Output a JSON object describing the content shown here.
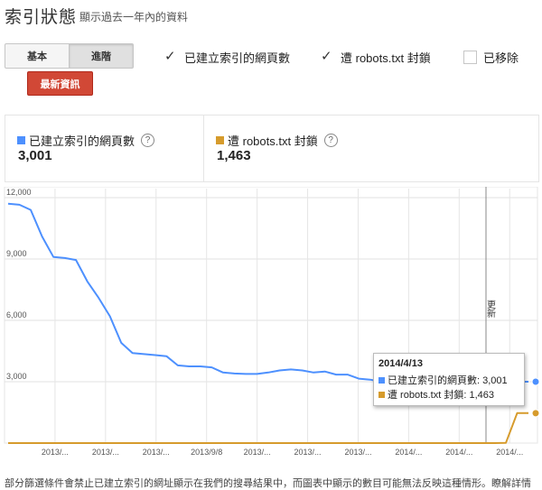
{
  "header": {
    "title": "索引狀態",
    "subtitle": "顯示過去一年內的資料"
  },
  "toolbar": {
    "basic_label": "基本",
    "advanced_label": "進階",
    "update_label": "最新資訊"
  },
  "filters": [
    {
      "label": "已建立索引的網頁數",
      "checked": true
    },
    {
      "label": "遭 robots.txt 封鎖",
      "checked": true
    },
    {
      "label": "已移除",
      "checked": false
    }
  ],
  "stats": [
    {
      "label": "已建立索引的網頁數",
      "value": "3,001",
      "color": "#4d90fe"
    },
    {
      "label": "遭 robots.txt 封鎖",
      "value": "1,463",
      "color": "#d69b2c"
    }
  ],
  "tooltip": {
    "date": "2014/4/13",
    "row1": "已建立索引的網頁數: 3,001",
    "row2": "遭 robots.txt 封鎖: 1,463"
  },
  "chart_data": {
    "type": "line",
    "ylim": [
      0,
      12000
    ],
    "yticks": [
      "12,000",
      "9,000",
      "6,000",
      "3,000"
    ],
    "ytick_values": [
      12000,
      9000,
      6000,
      3000
    ],
    "xtick_labels": [
      "2013/...",
      "2013/...",
      "2013/...",
      "2013/9/8",
      "2013/...",
      "2013/...",
      "2013/...",
      "2014/...",
      "2014/...",
      "2014/..."
    ],
    "annotation": "更新",
    "grid": true,
    "series": [
      {
        "name": "已建立索引的網頁數",
        "color": "#4d90fe",
        "values": [
          11700,
          11650,
          11400,
          10100,
          9100,
          9050,
          8950,
          7900,
          7100,
          6200,
          4900,
          4400,
          4350,
          4300,
          4250,
          3800,
          3750,
          3750,
          3700,
          3450,
          3400,
          3380,
          3380,
          3450,
          3550,
          3600,
          3550,
          3450,
          3500,
          3350,
          3350,
          3150,
          3100,
          3001,
          3001,
          3001,
          3001,
          3001,
          3001,
          3001,
          3001,
          3001,
          3001,
          3001,
          3001,
          3001,
          3001
        ]
      },
      {
        "name": "遭 robots.txt 封鎖",
        "color": "#d69b2c",
        "values": [
          0,
          0,
          0,
          0,
          0,
          0,
          0,
          0,
          0,
          0,
          0,
          0,
          0,
          0,
          0,
          0,
          0,
          0,
          0,
          0,
          0,
          0,
          0,
          0,
          0,
          0,
          0,
          0,
          0,
          0,
          0,
          0,
          0,
          0,
          0,
          0,
          0,
          0,
          0,
          0,
          0,
          0,
          0,
          0,
          10,
          1463,
          1463
        ]
      }
    ]
  },
  "footer": {
    "text": "部分篩選條件會禁止已建立索引的網址顯示在我們的搜尋結果中，而圖表中顯示的數目可能無法反映這種情形。",
    "link": "瞭解詳情"
  }
}
